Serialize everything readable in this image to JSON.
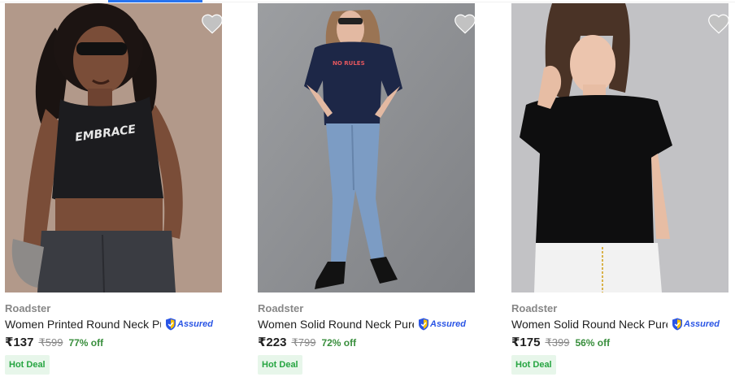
{
  "colors": {
    "accent": "#2874f0",
    "brand_text": "#878787",
    "discount": "#388e3c",
    "hot_deal_text": "#26a541",
    "hot_deal_bg": "#e7f6ea",
    "assured": "#2a55e5",
    "wishlist": "#c2c2c2"
  },
  "products": [
    {
      "brand": "Roadster",
      "title": "Women Printed Round Neck Pur...",
      "assured_label": "Assured",
      "price": "₹137",
      "mrp": "₹599",
      "discount": "77% off",
      "badge": "Hot Deal",
      "wishlist_icon": "heart-icon"
    },
    {
      "brand": "Roadster",
      "title": "Women Solid Round Neck Pure ...",
      "assured_label": "Assured",
      "price": "₹223",
      "mrp": "₹799",
      "discount": "72% off",
      "badge": "Hot Deal",
      "wishlist_icon": "heart-icon"
    },
    {
      "brand": "Roadster",
      "title": "Women Solid Round Neck Pure ...",
      "assured_label": "Assured",
      "price": "₹175",
      "mrp": "₹399",
      "discount": "56% off",
      "badge": "Hot Deal",
      "wishlist_icon": "heart-icon"
    }
  ]
}
